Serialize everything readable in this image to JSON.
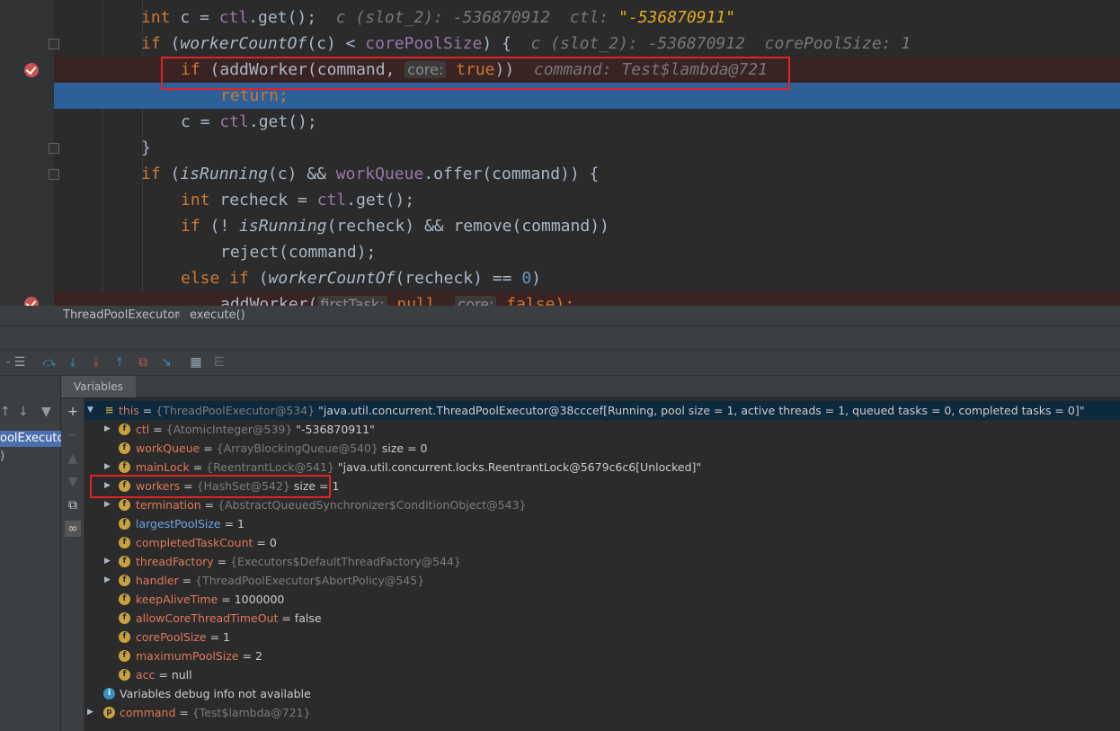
{
  "editor": {
    "lines": [
      {
        "id": "l1",
        "tokens": [
          {
            "t": "int",
            "c": "kw"
          },
          {
            "t": " c = ",
            "c": "plain"
          },
          {
            "t": "ctl",
            "c": "fld"
          },
          {
            "t": ".get();",
            "c": "plain"
          },
          {
            "t": "  c (slot_2): -536870912  ctl: ",
            "c": "hint"
          },
          {
            "t": "\"-536870911\"",
            "c": "hintstr"
          }
        ]
      },
      {
        "id": "l2",
        "tokens": [
          {
            "t": "if",
            "c": "kw"
          },
          {
            "t": " (",
            "c": "plain"
          },
          {
            "t": "workerCountOf",
            "c": "itl"
          },
          {
            "t": "(c) < ",
            "c": "plain"
          },
          {
            "t": "corePoolSize",
            "c": "fld"
          },
          {
            "t": ") {",
            "c": "plain"
          },
          {
            "t": "  c (slot_2): -536870912  corePoolSize: 1",
            "c": "hint"
          }
        ]
      },
      {
        "id": "l3",
        "tokens": [
          {
            "t": "if",
            "c": "kw"
          },
          {
            "t": " (addWorker(command, ",
            "c": "plain"
          },
          {
            "t": "core:",
            "c": "param-hint"
          },
          {
            "t": " ",
            "c": "plain"
          },
          {
            "t": "true",
            "c": "kw"
          },
          {
            "t": "))",
            "c": "plain"
          },
          {
            "t": "  command: Test$lambda@721",
            "c": "hint"
          }
        ]
      },
      {
        "id": "l4",
        "tokens": [
          {
            "t": "return;",
            "c": "kw"
          }
        ]
      },
      {
        "id": "l5",
        "tokens": [
          {
            "t": "c = ",
            "c": "plain"
          },
          {
            "t": "ctl",
            "c": "fld"
          },
          {
            "t": ".get();",
            "c": "plain"
          }
        ]
      },
      {
        "id": "l6",
        "tokens": [
          {
            "t": "}",
            "c": "plain"
          }
        ]
      },
      {
        "id": "l7",
        "tokens": [
          {
            "t": "if",
            "c": "kw"
          },
          {
            "t": " (",
            "c": "plain"
          },
          {
            "t": "isRunning",
            "c": "itl"
          },
          {
            "t": "(c) && ",
            "c": "plain"
          },
          {
            "t": "workQueue",
            "c": "fld"
          },
          {
            "t": ".offer(command)) {",
            "c": "plain"
          }
        ]
      },
      {
        "id": "l8",
        "tokens": [
          {
            "t": "int",
            "c": "kw"
          },
          {
            "t": " recheck = ",
            "c": "plain"
          },
          {
            "t": "ctl",
            "c": "fld"
          },
          {
            "t": ".get();",
            "c": "plain"
          }
        ]
      },
      {
        "id": "l9",
        "tokens": [
          {
            "t": "if",
            "c": "kw"
          },
          {
            "t": " (! ",
            "c": "plain"
          },
          {
            "t": "isRunning",
            "c": "itl"
          },
          {
            "t": "(recheck) && remove(command))",
            "c": "plain"
          }
        ]
      },
      {
        "id": "l10",
        "tokens": [
          {
            "t": "reject(command);",
            "c": "plain"
          }
        ]
      },
      {
        "id": "l11",
        "tokens": [
          {
            "t": "else if",
            "c": "kw"
          },
          {
            "t": " (",
            "c": "plain"
          },
          {
            "t": "workerCountOf",
            "c": "itl"
          },
          {
            "t": "(recheck) == ",
            "c": "plain"
          },
          {
            "t": "0",
            "c": "num"
          },
          {
            "t": ")",
            "c": "plain"
          }
        ]
      },
      {
        "id": "l12",
        "tokens": [
          {
            "t": "addWorker(",
            "c": "plain"
          },
          {
            "t": "firstTask:",
            "c": "param-hint"
          },
          {
            "t": " null, ",
            "c": "kw"
          },
          {
            "t": "core:",
            "c": "param-hint"
          },
          {
            "t": " false);",
            "c": "kw"
          }
        ]
      }
    ]
  },
  "breadcrumb": {
    "class_name": "ThreadPoolExecutor",
    "separator": "›",
    "method_name": "execute()"
  },
  "debugger": {
    "vars_tab_label": "Variables",
    "frame_selected": "oolExecutor",
    "frame_second": ")",
    "rows": [
      {
        "name": "this",
        "type": "{ThreadPoolExecutor@534}",
        "value": "\"java.util.concurrent.ThreadPoolExecutor@38cccef[Running, pool size = 1, active threads = 1, queued tasks = 0, completed tasks = 0]\""
      },
      {
        "name": "ctl",
        "type": "{AtomicInteger@539}",
        "value": "\"-536870911\""
      },
      {
        "name": "workQueue",
        "type": "{ArrayBlockingQueue@540}",
        "value": " size = 0"
      },
      {
        "name": "mainLock",
        "type": "{ReentrantLock@541}",
        "value": "\"java.util.concurrent.locks.ReentrantLock@5679c6c6[Unlocked]\""
      },
      {
        "name": "workers",
        "type": "{HashSet@542}",
        "value": " size = 1"
      },
      {
        "name": "termination",
        "type": "{AbstractQueuedSynchronizer$ConditionObject@543}",
        "value": ""
      },
      {
        "name": "largestPoolSize",
        "type": "",
        "value": "1"
      },
      {
        "name": "completedTaskCount",
        "type": "",
        "value": "0"
      },
      {
        "name": "threadFactory",
        "type": "{Executors$DefaultThreadFactory@544}",
        "value": ""
      },
      {
        "name": "handler",
        "type": "{ThreadPoolExecutor$AbortPolicy@545}",
        "value": ""
      },
      {
        "name": "keepAliveTime",
        "type": "",
        "value": "1000000"
      },
      {
        "name": "allowCoreThreadTimeOut",
        "type": "",
        "value": "false"
      },
      {
        "name": "corePoolSize",
        "type": "",
        "value": "1"
      },
      {
        "name": "maximumPoolSize",
        "type": "",
        "value": "2"
      },
      {
        "name": "acc",
        "type": "",
        "value": "null"
      },
      {
        "name": "",
        "type": "",
        "value": "Variables debug info not available"
      },
      {
        "name": "command",
        "type": "{Test$lambda@721}",
        "value": ""
      }
    ]
  }
}
